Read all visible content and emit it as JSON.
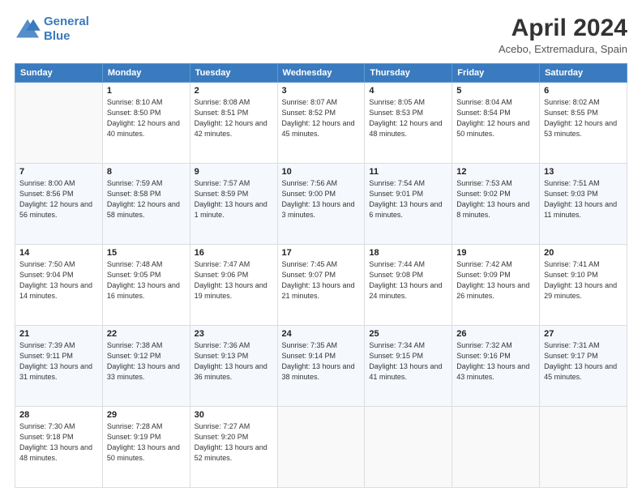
{
  "logo": {
    "line1": "General",
    "line2": "Blue"
  },
  "header": {
    "month": "April 2024",
    "location": "Acebo, Extremadura, Spain"
  },
  "weekdays": [
    "Sunday",
    "Monday",
    "Tuesday",
    "Wednesday",
    "Thursday",
    "Friday",
    "Saturday"
  ],
  "weeks": [
    [
      {
        "day": "",
        "empty": true
      },
      {
        "day": "1",
        "sunrise": "Sunrise: 8:10 AM",
        "sunset": "Sunset: 8:50 PM",
        "daylight": "Daylight: 12 hours and 40 minutes."
      },
      {
        "day": "2",
        "sunrise": "Sunrise: 8:08 AM",
        "sunset": "Sunset: 8:51 PM",
        "daylight": "Daylight: 12 hours and 42 minutes."
      },
      {
        "day": "3",
        "sunrise": "Sunrise: 8:07 AM",
        "sunset": "Sunset: 8:52 PM",
        "daylight": "Daylight: 12 hours and 45 minutes."
      },
      {
        "day": "4",
        "sunrise": "Sunrise: 8:05 AM",
        "sunset": "Sunset: 8:53 PM",
        "daylight": "Daylight: 12 hours and 48 minutes."
      },
      {
        "day": "5",
        "sunrise": "Sunrise: 8:04 AM",
        "sunset": "Sunset: 8:54 PM",
        "daylight": "Daylight: 12 hours and 50 minutes."
      },
      {
        "day": "6",
        "sunrise": "Sunrise: 8:02 AM",
        "sunset": "Sunset: 8:55 PM",
        "daylight": "Daylight: 12 hours and 53 minutes."
      }
    ],
    [
      {
        "day": "7",
        "sunrise": "Sunrise: 8:00 AM",
        "sunset": "Sunset: 8:56 PM",
        "daylight": "Daylight: 12 hours and 56 minutes."
      },
      {
        "day": "8",
        "sunrise": "Sunrise: 7:59 AM",
        "sunset": "Sunset: 8:58 PM",
        "daylight": "Daylight: 12 hours and 58 minutes."
      },
      {
        "day": "9",
        "sunrise": "Sunrise: 7:57 AM",
        "sunset": "Sunset: 8:59 PM",
        "daylight": "Daylight: 13 hours and 1 minute."
      },
      {
        "day": "10",
        "sunrise": "Sunrise: 7:56 AM",
        "sunset": "Sunset: 9:00 PM",
        "daylight": "Daylight: 13 hours and 3 minutes."
      },
      {
        "day": "11",
        "sunrise": "Sunrise: 7:54 AM",
        "sunset": "Sunset: 9:01 PM",
        "daylight": "Daylight: 13 hours and 6 minutes."
      },
      {
        "day": "12",
        "sunrise": "Sunrise: 7:53 AM",
        "sunset": "Sunset: 9:02 PM",
        "daylight": "Daylight: 13 hours and 8 minutes."
      },
      {
        "day": "13",
        "sunrise": "Sunrise: 7:51 AM",
        "sunset": "Sunset: 9:03 PM",
        "daylight": "Daylight: 13 hours and 11 minutes."
      }
    ],
    [
      {
        "day": "14",
        "sunrise": "Sunrise: 7:50 AM",
        "sunset": "Sunset: 9:04 PM",
        "daylight": "Daylight: 13 hours and 14 minutes."
      },
      {
        "day": "15",
        "sunrise": "Sunrise: 7:48 AM",
        "sunset": "Sunset: 9:05 PM",
        "daylight": "Daylight: 13 hours and 16 minutes."
      },
      {
        "day": "16",
        "sunrise": "Sunrise: 7:47 AM",
        "sunset": "Sunset: 9:06 PM",
        "daylight": "Daylight: 13 hours and 19 minutes."
      },
      {
        "day": "17",
        "sunrise": "Sunrise: 7:45 AM",
        "sunset": "Sunset: 9:07 PM",
        "daylight": "Daylight: 13 hours and 21 minutes."
      },
      {
        "day": "18",
        "sunrise": "Sunrise: 7:44 AM",
        "sunset": "Sunset: 9:08 PM",
        "daylight": "Daylight: 13 hours and 24 minutes."
      },
      {
        "day": "19",
        "sunrise": "Sunrise: 7:42 AM",
        "sunset": "Sunset: 9:09 PM",
        "daylight": "Daylight: 13 hours and 26 minutes."
      },
      {
        "day": "20",
        "sunrise": "Sunrise: 7:41 AM",
        "sunset": "Sunset: 9:10 PM",
        "daylight": "Daylight: 13 hours and 29 minutes."
      }
    ],
    [
      {
        "day": "21",
        "sunrise": "Sunrise: 7:39 AM",
        "sunset": "Sunset: 9:11 PM",
        "daylight": "Daylight: 13 hours and 31 minutes."
      },
      {
        "day": "22",
        "sunrise": "Sunrise: 7:38 AM",
        "sunset": "Sunset: 9:12 PM",
        "daylight": "Daylight: 13 hours and 33 minutes."
      },
      {
        "day": "23",
        "sunrise": "Sunrise: 7:36 AM",
        "sunset": "Sunset: 9:13 PM",
        "daylight": "Daylight: 13 hours and 36 minutes."
      },
      {
        "day": "24",
        "sunrise": "Sunrise: 7:35 AM",
        "sunset": "Sunset: 9:14 PM",
        "daylight": "Daylight: 13 hours and 38 minutes."
      },
      {
        "day": "25",
        "sunrise": "Sunrise: 7:34 AM",
        "sunset": "Sunset: 9:15 PM",
        "daylight": "Daylight: 13 hours and 41 minutes."
      },
      {
        "day": "26",
        "sunrise": "Sunrise: 7:32 AM",
        "sunset": "Sunset: 9:16 PM",
        "daylight": "Daylight: 13 hours and 43 minutes."
      },
      {
        "day": "27",
        "sunrise": "Sunrise: 7:31 AM",
        "sunset": "Sunset: 9:17 PM",
        "daylight": "Daylight: 13 hours and 45 minutes."
      }
    ],
    [
      {
        "day": "28",
        "sunrise": "Sunrise: 7:30 AM",
        "sunset": "Sunset: 9:18 PM",
        "daylight": "Daylight: 13 hours and 48 minutes."
      },
      {
        "day": "29",
        "sunrise": "Sunrise: 7:28 AM",
        "sunset": "Sunset: 9:19 PM",
        "daylight": "Daylight: 13 hours and 50 minutes."
      },
      {
        "day": "30",
        "sunrise": "Sunrise: 7:27 AM",
        "sunset": "Sunset: 9:20 PM",
        "daylight": "Daylight: 13 hours and 52 minutes."
      },
      {
        "day": "",
        "empty": true
      },
      {
        "day": "",
        "empty": true
      },
      {
        "day": "",
        "empty": true
      },
      {
        "day": "",
        "empty": true
      }
    ]
  ]
}
